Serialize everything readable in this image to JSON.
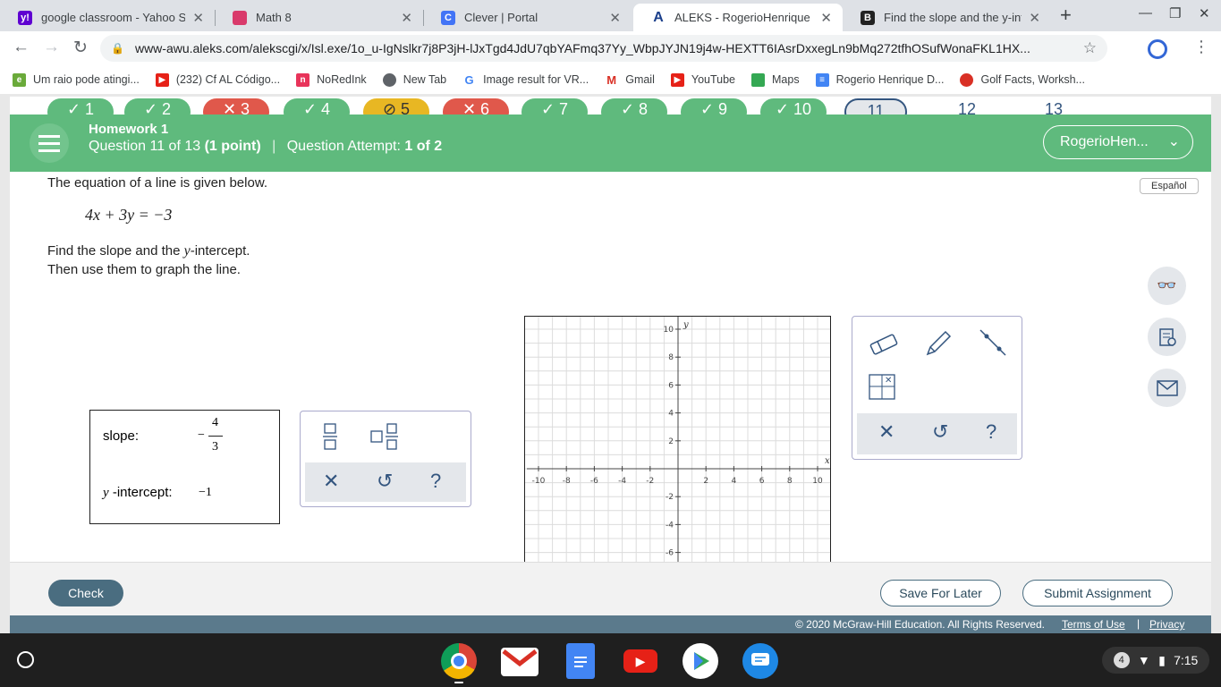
{
  "browser": {
    "tabs": [
      {
        "title": "google classroom - Yahoo Se",
        "fav_label": "y!",
        "fav_color": "#5f01d1"
      },
      {
        "title": "Math 8",
        "fav_label": "",
        "fav_color": "#d93a6b"
      },
      {
        "title": "Clever | Portal",
        "fav_label": "C",
        "fav_color": "#4274f6"
      },
      {
        "title": "ALEKS - RogerioHenrique De.",
        "fav_label": "A",
        "fav_color": "#ffffff"
      },
      {
        "title": "Find the slope and the y-interc",
        "fav_label": "B",
        "fav_color": "#222222"
      }
    ],
    "url": "www-awu.aleks.com/alekscgi/x/Isl.exe/1o_u-IgNslkr7j8P3jH-lJxTgd4JdU7qbYAFmq37Yy_WbpJYJN19j4w-HEXTT6IAsrDxxegLn9bMq272tfhOSufWonaFKL1HX...",
    "bookmarks": [
      {
        "label": "Um raio pode atingi...",
        "icon": "e-icon",
        "color": "#6aaa3a"
      },
      {
        "label": "(232) Cf AL Código...",
        "icon": "youtube-icon",
        "color": "#e62117"
      },
      {
        "label": "NoRedInk",
        "icon": "noredink-icon",
        "color": "#e8345a"
      },
      {
        "label": "New Tab",
        "icon": "globe-icon",
        "color": "#5f6368"
      },
      {
        "label": "Image result for VR...",
        "icon": "google-icon",
        "color": "#4285f4"
      },
      {
        "label": "Gmail",
        "icon": "gmail-icon",
        "color": "#d93025"
      },
      {
        "label": "YouTube",
        "icon": "youtube-icon",
        "color": "#e62117"
      },
      {
        "label": "Maps",
        "icon": "maps-icon",
        "color": "#34a853"
      },
      {
        "label": "Rogerio Henrique D...",
        "icon": "docs-icon",
        "color": "#4285f4"
      },
      {
        "label": "Golf Facts, Worksh...",
        "icon": "apple-icon",
        "color": "#d93025"
      }
    ]
  },
  "aleks": {
    "question_nav": [
      {
        "label": "✓ 1",
        "color": "#5fba7d"
      },
      {
        "label": "✓ 2",
        "color": "#5fba7d"
      },
      {
        "label": "✕ 3",
        "color": "#e0584b"
      },
      {
        "label": "✓ 4",
        "color": "#5fba7d"
      },
      {
        "label": "⊘ 5",
        "color": "#e8b723"
      },
      {
        "label": "✕ 6",
        "color": "#e0584b"
      },
      {
        "label": "✓ 7",
        "color": "#5fba7d"
      },
      {
        "label": "✓ 8",
        "color": "#5fba7d"
      },
      {
        "label": "✓ 9",
        "color": "#5fba7d"
      },
      {
        "label": "✓ 10",
        "color": "#5fba7d"
      },
      {
        "label": "11",
        "color": "#ffffff"
      },
      {
        "label": "12",
        "color": "#ffffff"
      },
      {
        "label": "13",
        "color": "#ffffff"
      }
    ],
    "homework": "Homework 1",
    "question_prefix": "Question 11 of 13",
    "points": "(1 point)",
    "attempt_prefix": "Question Attempt:",
    "attempt": "1 of 2",
    "user": "RogerioHen...",
    "espanol": "Español",
    "prompt": "The equation of a line is given below.",
    "equation": "4x + 3y = −3",
    "find_pre": "Find the slope and the ",
    "find_var": "y",
    "find_post": "-intercept.",
    "then": "Then use them to graph the line.",
    "answer": {
      "slope_label": "slope:",
      "slope_sign": "−",
      "slope_num": "4",
      "slope_den": "3",
      "yint_var": "y",
      "yint_label": " -intercept:",
      "yint_value": "−1"
    },
    "graph": {
      "x_label": "x",
      "y_label": "y",
      "x_ticks": [
        "-10",
        "-8",
        "-6",
        "-4",
        "-2",
        "2",
        "4",
        "6",
        "8",
        "10"
      ],
      "y_ticks": [
        "10",
        "8",
        "6",
        "4",
        "2",
        "-2",
        "-4",
        "-6"
      ]
    },
    "check": "Check",
    "save": "Save For Later",
    "submit": "Submit Assignment",
    "copyright": "© 2020 McGraw-Hill Education. All Rights Reserved.",
    "terms": "Terms of Use",
    "privacy": "Privacy"
  },
  "shelf": {
    "battery": "4",
    "time": "7:15"
  }
}
